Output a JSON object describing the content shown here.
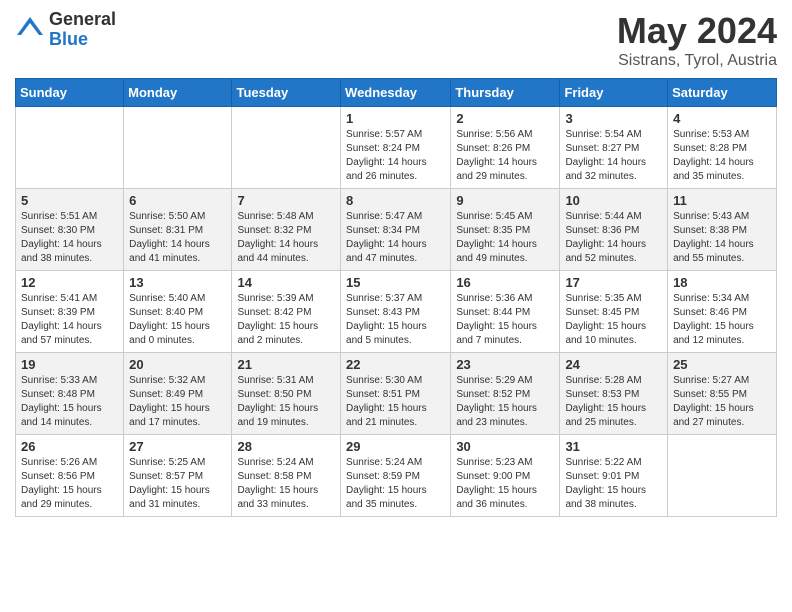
{
  "header": {
    "logo_general": "General",
    "logo_blue": "Blue",
    "title": "May 2024",
    "location": "Sistrans, Tyrol, Austria"
  },
  "calendar": {
    "days_of_week": [
      "Sunday",
      "Monday",
      "Tuesday",
      "Wednesday",
      "Thursday",
      "Friday",
      "Saturday"
    ],
    "weeks": [
      [
        {
          "day": "",
          "sunrise": "",
          "sunset": "",
          "daylight": ""
        },
        {
          "day": "",
          "sunrise": "",
          "sunset": "",
          "daylight": ""
        },
        {
          "day": "",
          "sunrise": "",
          "sunset": "",
          "daylight": ""
        },
        {
          "day": "1",
          "sunrise": "Sunrise: 5:57 AM",
          "sunset": "Sunset: 8:24 PM",
          "daylight": "Daylight: 14 hours and 26 minutes."
        },
        {
          "day": "2",
          "sunrise": "Sunrise: 5:56 AM",
          "sunset": "Sunset: 8:26 PM",
          "daylight": "Daylight: 14 hours and 29 minutes."
        },
        {
          "day": "3",
          "sunrise": "Sunrise: 5:54 AM",
          "sunset": "Sunset: 8:27 PM",
          "daylight": "Daylight: 14 hours and 32 minutes."
        },
        {
          "day": "4",
          "sunrise": "Sunrise: 5:53 AM",
          "sunset": "Sunset: 8:28 PM",
          "daylight": "Daylight: 14 hours and 35 minutes."
        }
      ],
      [
        {
          "day": "5",
          "sunrise": "Sunrise: 5:51 AM",
          "sunset": "Sunset: 8:30 PM",
          "daylight": "Daylight: 14 hours and 38 minutes."
        },
        {
          "day": "6",
          "sunrise": "Sunrise: 5:50 AM",
          "sunset": "Sunset: 8:31 PM",
          "daylight": "Daylight: 14 hours and 41 minutes."
        },
        {
          "day": "7",
          "sunrise": "Sunrise: 5:48 AM",
          "sunset": "Sunset: 8:32 PM",
          "daylight": "Daylight: 14 hours and 44 minutes."
        },
        {
          "day": "8",
          "sunrise": "Sunrise: 5:47 AM",
          "sunset": "Sunset: 8:34 PM",
          "daylight": "Daylight: 14 hours and 47 minutes."
        },
        {
          "day": "9",
          "sunrise": "Sunrise: 5:45 AM",
          "sunset": "Sunset: 8:35 PM",
          "daylight": "Daylight: 14 hours and 49 minutes."
        },
        {
          "day": "10",
          "sunrise": "Sunrise: 5:44 AM",
          "sunset": "Sunset: 8:36 PM",
          "daylight": "Daylight: 14 hours and 52 minutes."
        },
        {
          "day": "11",
          "sunrise": "Sunrise: 5:43 AM",
          "sunset": "Sunset: 8:38 PM",
          "daylight": "Daylight: 14 hours and 55 minutes."
        }
      ],
      [
        {
          "day": "12",
          "sunrise": "Sunrise: 5:41 AM",
          "sunset": "Sunset: 8:39 PM",
          "daylight": "Daylight: 14 hours and 57 minutes."
        },
        {
          "day": "13",
          "sunrise": "Sunrise: 5:40 AM",
          "sunset": "Sunset: 8:40 PM",
          "daylight": "Daylight: 15 hours and 0 minutes."
        },
        {
          "day": "14",
          "sunrise": "Sunrise: 5:39 AM",
          "sunset": "Sunset: 8:42 PM",
          "daylight": "Daylight: 15 hours and 2 minutes."
        },
        {
          "day": "15",
          "sunrise": "Sunrise: 5:37 AM",
          "sunset": "Sunset: 8:43 PM",
          "daylight": "Daylight: 15 hours and 5 minutes."
        },
        {
          "day": "16",
          "sunrise": "Sunrise: 5:36 AM",
          "sunset": "Sunset: 8:44 PM",
          "daylight": "Daylight: 15 hours and 7 minutes."
        },
        {
          "day": "17",
          "sunrise": "Sunrise: 5:35 AM",
          "sunset": "Sunset: 8:45 PM",
          "daylight": "Daylight: 15 hours and 10 minutes."
        },
        {
          "day": "18",
          "sunrise": "Sunrise: 5:34 AM",
          "sunset": "Sunset: 8:46 PM",
          "daylight": "Daylight: 15 hours and 12 minutes."
        }
      ],
      [
        {
          "day": "19",
          "sunrise": "Sunrise: 5:33 AM",
          "sunset": "Sunset: 8:48 PM",
          "daylight": "Daylight: 15 hours and 14 minutes."
        },
        {
          "day": "20",
          "sunrise": "Sunrise: 5:32 AM",
          "sunset": "Sunset: 8:49 PM",
          "daylight": "Daylight: 15 hours and 17 minutes."
        },
        {
          "day": "21",
          "sunrise": "Sunrise: 5:31 AM",
          "sunset": "Sunset: 8:50 PM",
          "daylight": "Daylight: 15 hours and 19 minutes."
        },
        {
          "day": "22",
          "sunrise": "Sunrise: 5:30 AM",
          "sunset": "Sunset: 8:51 PM",
          "daylight": "Daylight: 15 hours and 21 minutes."
        },
        {
          "day": "23",
          "sunrise": "Sunrise: 5:29 AM",
          "sunset": "Sunset: 8:52 PM",
          "daylight": "Daylight: 15 hours and 23 minutes."
        },
        {
          "day": "24",
          "sunrise": "Sunrise: 5:28 AM",
          "sunset": "Sunset: 8:53 PM",
          "daylight": "Daylight: 15 hours and 25 minutes."
        },
        {
          "day": "25",
          "sunrise": "Sunrise: 5:27 AM",
          "sunset": "Sunset: 8:55 PM",
          "daylight": "Daylight: 15 hours and 27 minutes."
        }
      ],
      [
        {
          "day": "26",
          "sunrise": "Sunrise: 5:26 AM",
          "sunset": "Sunset: 8:56 PM",
          "daylight": "Daylight: 15 hours and 29 minutes."
        },
        {
          "day": "27",
          "sunrise": "Sunrise: 5:25 AM",
          "sunset": "Sunset: 8:57 PM",
          "daylight": "Daylight: 15 hours and 31 minutes."
        },
        {
          "day": "28",
          "sunrise": "Sunrise: 5:24 AM",
          "sunset": "Sunset: 8:58 PM",
          "daylight": "Daylight: 15 hours and 33 minutes."
        },
        {
          "day": "29",
          "sunrise": "Sunrise: 5:24 AM",
          "sunset": "Sunset: 8:59 PM",
          "daylight": "Daylight: 15 hours and 35 minutes."
        },
        {
          "day": "30",
          "sunrise": "Sunrise: 5:23 AM",
          "sunset": "Sunset: 9:00 PM",
          "daylight": "Daylight: 15 hours and 36 minutes."
        },
        {
          "day": "31",
          "sunrise": "Sunrise: 5:22 AM",
          "sunset": "Sunset: 9:01 PM",
          "daylight": "Daylight: 15 hours and 38 minutes."
        },
        {
          "day": "",
          "sunrise": "",
          "sunset": "",
          "daylight": ""
        }
      ]
    ]
  }
}
